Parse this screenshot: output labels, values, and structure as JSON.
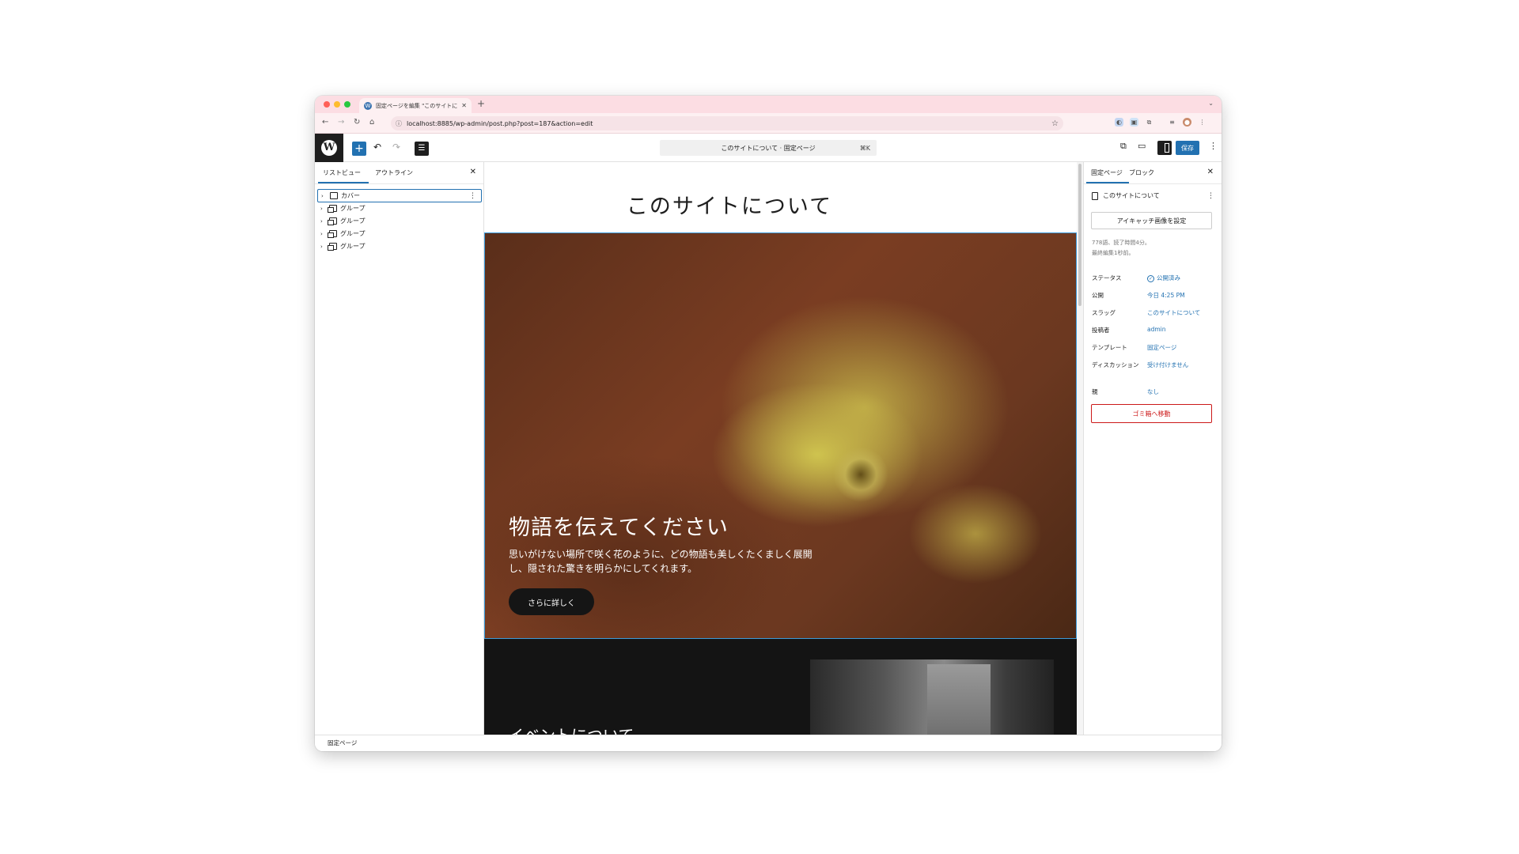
{
  "browser": {
    "tab_title": "固定ページを編集 \"このサイトに",
    "url": "localhost:8885/wp-admin/post.php?post=187&action=edit",
    "colors": {
      "tabstrip": "#fcdde3",
      "red": "#ff5f57",
      "yellow": "#febc2e",
      "green": "#28c840"
    }
  },
  "editor_header": {
    "inserter_icon": "plus-icon",
    "undo_icon": "undo-icon",
    "redo_icon": "redo-icon",
    "document_overview_icon": "list-view-icon",
    "command_bar_label": "このサイトについて · 固定ページ",
    "command_bar_shortcut": "⌘K",
    "save_label": "保存",
    "accent": "#2271b1"
  },
  "list_view": {
    "tabs": [
      "リストビュー",
      "アウトライン"
    ],
    "items": [
      {
        "label": "カバー",
        "selected": true
      },
      {
        "label": "グループ"
      },
      {
        "label": "グループ"
      },
      {
        "label": "グループ"
      },
      {
        "label": "グループ"
      }
    ]
  },
  "canvas": {
    "page_title": "このサイトについて",
    "cover_heading": "物語を伝えてください",
    "cover_text": "思いがけない場所で咲く花のように、どの物語も美しくたくましく展開し、隠された驚きを明らかにしてくれます。",
    "cover_button": "さらに詳しく",
    "next_section_heading": "イベントについて"
  },
  "settings_sidebar": {
    "tabs": [
      "固定ページ",
      "ブロック"
    ],
    "doc_title": "このサイトについて",
    "featured_image_button": "アイキャッチ画像を設定",
    "stats_line1": "778語、読了時間4分。",
    "stats_line2": "最終編集1秒前。",
    "meta": [
      {
        "label": "ステータス",
        "value": "公開済み"
      },
      {
        "label": "公開",
        "value": "今日 4:25 PM"
      },
      {
        "label": "スラッグ",
        "value": "このサイトについて"
      },
      {
        "label": "投稿者",
        "value": "admin"
      },
      {
        "label": "テンプレート",
        "value": "固定ページ"
      },
      {
        "label": "ディスカッション",
        "value": "受け付けません"
      },
      {
        "label": "親",
        "value": "なし"
      }
    ],
    "trash_button": "ゴミ箱へ移動",
    "danger_color": "#cc1818"
  },
  "footer": {
    "breadcrumb": "固定ページ"
  }
}
